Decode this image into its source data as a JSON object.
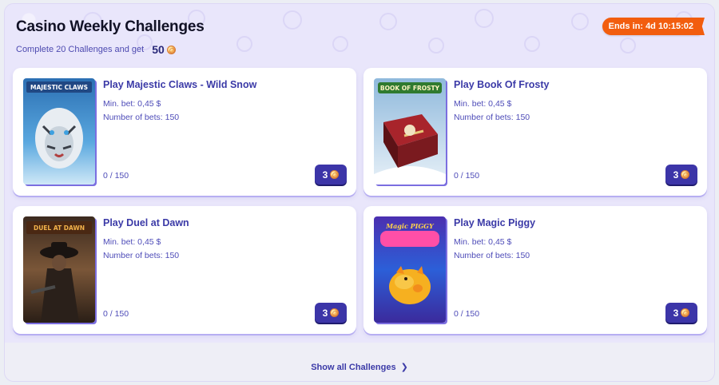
{
  "header": {
    "title": "Casino Weekly Challenges",
    "subtitle": "Complete 20 Challenges and get",
    "reward_amount": "50",
    "timer": "Ends in: 4d 10:15:02",
    "coin_icon": "coin-icon"
  },
  "challenges": [
    {
      "title": "Play Majestic Claws - Wild Snow",
      "min_bet": "Min. bet: 0,45 $",
      "bets": "Number of bets: 150",
      "progress": "0 / 150",
      "reward": "3",
      "thumb_text": "MAJESTIC CLAWS"
    },
    {
      "title": "Play Book Of Frosty",
      "min_bet": "Min. bet: 0,45 $",
      "bets": "Number of bets: 150",
      "progress": "0 / 150",
      "reward": "3",
      "thumb_text": "BOOK OF FROSTY"
    },
    {
      "title": "Play Duel at Dawn",
      "min_bet": "Min. bet: 0,45 $",
      "bets": "Number of bets: 150",
      "progress": "0 / 150",
      "reward": "3",
      "thumb_text": "DUEL AT DAWN"
    },
    {
      "title": "Play Magic Piggy",
      "min_bet": "Min. bet: 0,45 $",
      "bets": "Number of bets: 150",
      "progress": "0 / 150",
      "reward": "3",
      "thumb_text": "Magic PIGGY"
    }
  ],
  "footer": {
    "show_all": "Show all Challenges",
    "chevron_icon": "chevron-right-icon"
  },
  "colors": {
    "timer_bg": "#f25d0e",
    "reward_button_bg": "#3c35a8",
    "panel_bg": "#e9e6fb",
    "accent_text": "#3b3aa7"
  }
}
